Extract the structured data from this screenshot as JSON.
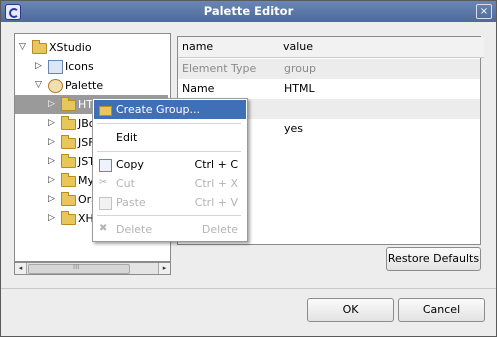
{
  "window": {
    "title": "Palette Editor",
    "close_glyph": "×"
  },
  "tree": {
    "items": [
      {
        "label": "XStudio",
        "twisty": "▽",
        "icon": "folder-open-icon"
      },
      {
        "label": "Icons",
        "twisty": "▷",
        "icon": "icons-icon"
      },
      {
        "label": "Palette",
        "twisty": "▽",
        "icon": "palette-icon"
      },
      {
        "label": "HT",
        "twisty": "▷",
        "icon": "folder-icon",
        "selected": true
      },
      {
        "label": "JBo",
        "twisty": "▷",
        "icon": "folder-icon"
      },
      {
        "label": "JSF",
        "twisty": "▷",
        "icon": "folder-icon"
      },
      {
        "label": "JST",
        "twisty": "▷",
        "icon": "folder-icon"
      },
      {
        "label": "My",
        "twisty": "▷",
        "icon": "folder-icon"
      },
      {
        "label": "Ora",
        "twisty": "▷",
        "icon": "folder-icon"
      },
      {
        "label": "XH",
        "twisty": "▷",
        "icon": "folder-icon"
      }
    ],
    "scrollbar": {
      "left_arrow": "◂",
      "right_arrow": "▸",
      "grip": "III"
    }
  },
  "table": {
    "headers": {
      "name": "name",
      "value": "value"
    },
    "rows": [
      {
        "name": "Element Type",
        "value": "group",
        "muted": true
      },
      {
        "name": "Name",
        "value": "HTML"
      },
      {
        "name": "",
        "value": ""
      },
      {
        "name": "",
        "value": "yes"
      }
    ]
  },
  "context_menu": {
    "items": [
      {
        "label": "Create Group...",
        "shortcut": "",
        "icon": "create-group-icon",
        "highlighted": true
      },
      {
        "label": "Edit",
        "shortcut": ""
      },
      {
        "label": "Copy",
        "shortcut": "Ctrl + C",
        "icon": "copy-icon"
      },
      {
        "label": "Cut",
        "shortcut": "Ctrl + X",
        "icon": "cut-icon",
        "disabled": true
      },
      {
        "label": "Paste",
        "shortcut": "Ctrl + V",
        "icon": "paste-icon",
        "disabled": true
      },
      {
        "label": "Delete",
        "shortcut": "Delete",
        "icon": "delete-icon",
        "disabled": true
      }
    ]
  },
  "buttons": {
    "restore_defaults": "Restore Defaults",
    "ok": "OK",
    "cancel": "Cancel"
  }
}
